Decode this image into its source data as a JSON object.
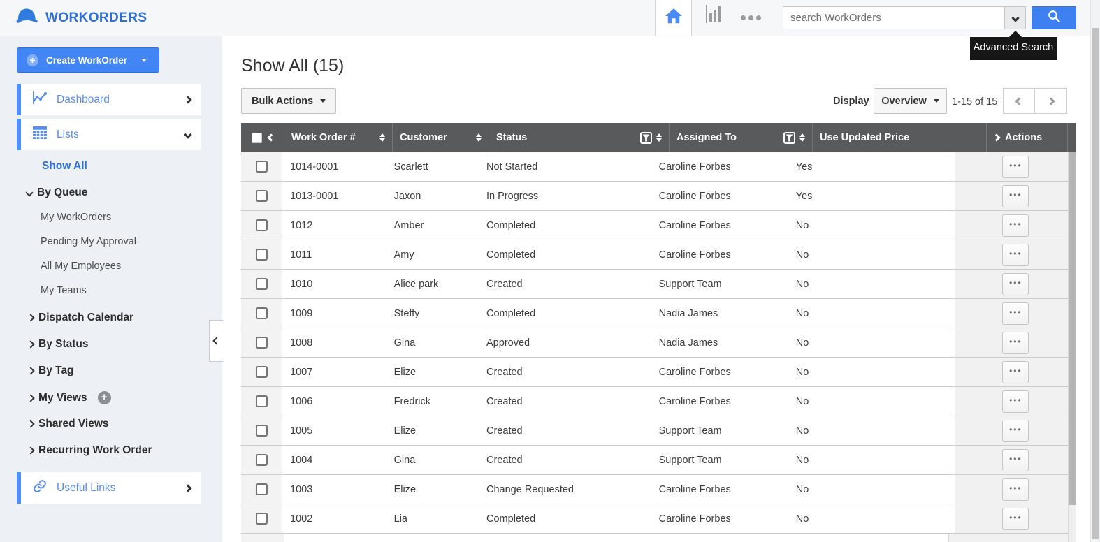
{
  "topbar": {
    "brand": "WORKORDERS",
    "search_placeholder": "search WorkOrders",
    "tooltip_text": "Advanced Search"
  },
  "sidebar": {
    "create_button_label": "Create WorkOrder",
    "dashboard_label": "Dashboard",
    "lists_label": "Lists",
    "useful_links_label": "Useful Links",
    "items": [
      {
        "type": "active",
        "label": "Show All"
      },
      {
        "type": "group-open",
        "label": "By Queue"
      },
      {
        "type": "sub",
        "label": "My WorkOrders"
      },
      {
        "type": "sub",
        "label": "Pending My Approval"
      },
      {
        "type": "sub",
        "label": "All My Employees"
      },
      {
        "type": "sub",
        "label": "My Teams"
      },
      {
        "type": "group",
        "label": "Dispatch Calendar"
      },
      {
        "type": "group",
        "label": "By Status"
      },
      {
        "type": "group",
        "label": "By Tag"
      },
      {
        "type": "group-plus",
        "label": "My Views"
      },
      {
        "type": "group",
        "label": "Shared Views"
      },
      {
        "type": "group",
        "label": "Recurring Work Order"
      }
    ]
  },
  "main": {
    "title": "Show All (15)",
    "bulk_actions_label": "Bulk Actions",
    "display_label": "Display",
    "display_value": "Overview",
    "range_text": "1-15 of 15"
  },
  "table": {
    "columns": [
      "Work Order #",
      "Customer",
      "Status",
      "Assigned To",
      "Use Updated Price",
      "Actions"
    ],
    "rows": [
      {
        "work_order": "1014-0001",
        "customer": "Scarlett",
        "status": "Not Started",
        "assigned_to": "Caroline Forbes",
        "use_updated_price": "Yes"
      },
      {
        "work_order": "1013-0001",
        "customer": "Jaxon",
        "status": "In Progress",
        "assigned_to": "Caroline Forbes",
        "use_updated_price": "Yes"
      },
      {
        "work_order": "1012",
        "customer": "Amber",
        "status": "Completed",
        "assigned_to": "Caroline Forbes",
        "use_updated_price": "No"
      },
      {
        "work_order": "1011",
        "customer": "Amy",
        "status": "Completed",
        "assigned_to": "Caroline Forbes",
        "use_updated_price": "No"
      },
      {
        "work_order": "1010",
        "customer": "Alice park",
        "status": "Created",
        "assigned_to": "Support Team",
        "use_updated_price": "No"
      },
      {
        "work_order": "1009",
        "customer": "Steffy",
        "status": "Completed",
        "assigned_to": "Nadia James",
        "use_updated_price": "No"
      },
      {
        "work_order": "1008",
        "customer": "Gina",
        "status": "Approved",
        "assigned_to": "Nadia James",
        "use_updated_price": "No"
      },
      {
        "work_order": "1007",
        "customer": "Elize",
        "status": "Created",
        "assigned_to": "Caroline Forbes",
        "use_updated_price": "No"
      },
      {
        "work_order": "1006",
        "customer": "Fredrick",
        "status": "Created",
        "assigned_to": "Caroline Forbes",
        "use_updated_price": "No"
      },
      {
        "work_order": "1005",
        "customer": "Elize",
        "status": "Created",
        "assigned_to": "Support Team",
        "use_updated_price": "No"
      },
      {
        "work_order": "1004",
        "customer": "Gina",
        "status": "Created",
        "assigned_to": "Support Team",
        "use_updated_price": "No"
      },
      {
        "work_order": "1003",
        "customer": "Elize",
        "status": "Change Requested",
        "assigned_to": "Caroline Forbes",
        "use_updated_price": "No"
      },
      {
        "work_order": "1002",
        "customer": "Lia",
        "status": "Completed",
        "assigned_to": "Caroline Forbes",
        "use_updated_price": "No"
      }
    ]
  },
  "icons": {
    "ellipsis": "•••"
  },
  "colors": {
    "accent_blue": "#4285f4",
    "link_blue": "#2e6fd9",
    "table_header_bg": "#595a5c",
    "sidebar_bg": "#edf0f5",
    "tooltip_bg": "#171717"
  }
}
